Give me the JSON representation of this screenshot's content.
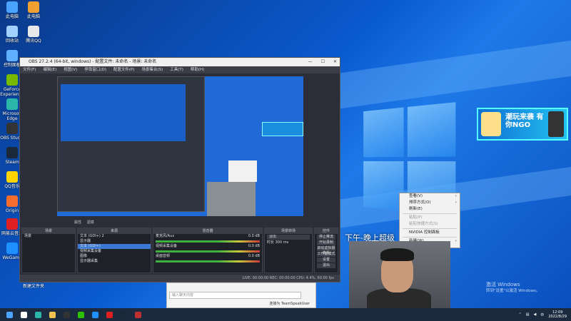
{
  "desktop_icons": [
    {
      "label": "此电脑",
      "icon": "computer-icon",
      "color": "#4aa3ff"
    },
    {
      "label": "此电脑",
      "icon": "doc-icon",
      "color": "#f0a030"
    },
    {
      "label": "回收站",
      "icon": "recycle-bin-icon",
      "color": "#9fd0ff"
    },
    {
      "label": "腾讯QQ",
      "icon": "app-icon",
      "color": "#e8e8e8"
    },
    {
      "label": "控制面板",
      "icon": "control-panel-icon",
      "color": "#5fb0ff"
    },
    {
      "label": "GeForce Experience",
      "icon": "nvidia-icon",
      "color": "#76b900"
    },
    {
      "label": "Microsoft Edge",
      "icon": "edge-icon",
      "color": "#2ab7a9"
    },
    {
      "label": "OBS Studio",
      "icon": "obs-icon",
      "color": "#333333"
    },
    {
      "label": "Steam",
      "icon": "steam-icon",
      "color": "#1b2838"
    },
    {
      "label": "QQ音乐",
      "icon": "music-icon",
      "color": "#ffd400"
    },
    {
      "label": "Origin",
      "icon": "origin-icon",
      "color": "#f56c2d"
    },
    {
      "label": "网易云音乐",
      "icon": "netease-icon",
      "color": "#e02020"
    },
    {
      "label": "WeGame",
      "icon": "wegame-icon",
      "color": "#1e90ff"
    },
    {
      "label": "新建文件夹",
      "icon": "folder-icon",
      "color": "#f2c14e"
    }
  ],
  "obs": {
    "title": "OBS 27.2.4 (64-bit, windows) - 配置文件: 未命名 - 场景: 未命名",
    "menu": [
      "文件(F)",
      "编辑(E)",
      "视图(V)",
      "停靠窗口(D)",
      "配置文件(P)",
      "场景集合(S)",
      "工具(T)",
      "帮助(H)"
    ],
    "source_tabs": [
      "属性",
      "滤镜"
    ],
    "panels": {
      "scenes": {
        "title": "场景",
        "items": [
          "场景"
        ]
      },
      "sources": {
        "title": "来源",
        "items": [
          "文本 (GDI+) 2",
          "显示器",
          "文本 (GDI+)",
          "视频采集设备",
          "图像",
          "显示器采集"
        ]
      },
      "mixer": {
        "title": "混音器",
        "channels": [
          {
            "name": "麦克风/Aux",
            "db": "0.0 dB"
          },
          {
            "name": "视频采集设备",
            "db": "0.0 dB"
          },
          {
            "name": "桌面音频",
            "db": "0.0 dB"
          }
        ]
      },
      "transitions": {
        "title": "场景转场",
        "type": "淡出",
        "duration_label": "时长",
        "duration": "300 ms"
      },
      "controls": {
        "title": "控件",
        "buttons": [
          "停止推流",
          "开始录制",
          "启动虚拟摄像机",
          "工作室模式",
          "设置",
          "退出"
        ]
      }
    },
    "status": "LIVE: 00:00:00  REC: 00:00:00  CPU: 4.4%, 60.00 fps"
  },
  "chat": {
    "placeholder": "输入聊天内容",
    "user": "连接为 TeamSpeakUser"
  },
  "banner": {
    "text": "潮玩来袭 有你NGO"
  },
  "context_menu": {
    "items": [
      {
        "label": "查看(V)",
        "submenu": true,
        "disabled": false
      },
      {
        "label": "排序方式(O)",
        "submenu": true,
        "disabled": false
      },
      {
        "label": "刷新(E)",
        "submenu": false,
        "disabled": false
      },
      {
        "label": "粘贴(P)",
        "submenu": false,
        "disabled": true
      },
      {
        "label": "粘贴快捷方式(S)",
        "submenu": false,
        "disabled": true
      },
      {
        "label": "NVIDIA 控制面板",
        "submenu": false,
        "disabled": false
      },
      {
        "label": "新建(W)",
        "submenu": true,
        "disabled": false
      }
    ]
  },
  "overlay_text": "下午-晚上超级",
  "watermark": {
    "line1": "激活 Windows",
    "line2": "转到\"设置\"以激活 Windows。"
  },
  "taskbar": {
    "apps": [
      {
        "icon": "start-icon",
        "color": "#4aa3ff"
      },
      {
        "icon": "search-icon",
        "color": "#ffffff"
      },
      {
        "icon": "edge-icon",
        "color": "#2ab7a9"
      },
      {
        "icon": "explorer-icon",
        "color": "#f2c14e"
      },
      {
        "icon": "obs-icon",
        "color": "#333333"
      },
      {
        "icon": "wechat-icon",
        "color": "#2dc100"
      },
      {
        "icon": "store-icon",
        "color": "#1e90ff"
      },
      {
        "icon": "netease-icon",
        "color": "#e02020"
      },
      {
        "icon": "steam-icon",
        "color": "#1b2838"
      },
      {
        "icon": "app-icon",
        "color": "#c03030"
      }
    ],
    "time": "12:09",
    "date": "2022/8/29"
  }
}
